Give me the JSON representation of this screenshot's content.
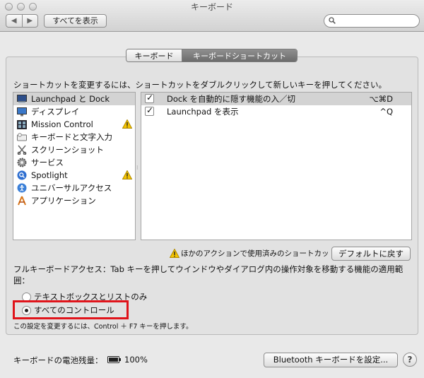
{
  "window": {
    "title": "キーボード"
  },
  "toolbar": {
    "back_glyph": "◀",
    "forward_glyph": "▶",
    "show_all_label": "すべてを表示",
    "search_placeholder": ""
  },
  "tabs": [
    {
      "label": "キーボード",
      "selected": false
    },
    {
      "label": "キーボードショートカット",
      "selected": true
    }
  ],
  "instruction": "ショートカットを変更するには、ショートカットをダブルクリックして新しいキーを押してください。",
  "categories": [
    {
      "label": "Launchpad と Dock",
      "icon": "launchpad-dock-icon",
      "selected": true,
      "warning": false
    },
    {
      "label": "ディスプレイ",
      "icon": "display-icon",
      "selected": false,
      "warning": false
    },
    {
      "label": "Mission Control",
      "icon": "mission-control-icon",
      "selected": false,
      "warning": true
    },
    {
      "label": "キーボードと文字入力",
      "icon": "keyboard-icon",
      "selected": false,
      "warning": false
    },
    {
      "label": "スクリーンショット",
      "icon": "screenshot-icon",
      "selected": false,
      "warning": false
    },
    {
      "label": "サービス",
      "icon": "services-gear-icon",
      "selected": false,
      "warning": false
    },
    {
      "label": "Spotlight",
      "icon": "spotlight-icon",
      "selected": false,
      "warning": true
    },
    {
      "label": "ユニバーサルアクセス",
      "icon": "universal-access-icon",
      "selected": false,
      "warning": false
    },
    {
      "label": "アプリケーション",
      "icon": "applications-icon",
      "selected": false,
      "warning": false
    }
  ],
  "shortcuts": [
    {
      "label": "Dock を自動的に隠す機能の入／切",
      "key": "⌥⌘D",
      "checked": true,
      "selected": true
    },
    {
      "label": "Launchpad を表示",
      "key": "^Q",
      "checked": true,
      "selected": false
    }
  ],
  "conflict_note": "ほかのアクションで使用済みのショートカット",
  "restore_defaults_label": "デフォルトに戻す",
  "full_keyboard_access": {
    "description": "フルキーボードアクセス：Tab キーを押してウインドウやダイアログ内の操作対象を移動する機能の適用範囲：",
    "options": [
      {
        "label": "テキストボックスとリストのみ",
        "selected": false
      },
      {
        "label": "すべてのコントロール",
        "selected": true
      }
    ],
    "hint": "この設定を変更するには、Control ＋ F7 キーを押します。"
  },
  "battery": {
    "label": "キーボードの電池残量：",
    "value": "100%",
    "level": 1.0
  },
  "bluetooth_button_label": "Bluetooth キーボードを設定...",
  "help_label": "?",
  "colors": {
    "highlight": "#e0141b",
    "warning": "#f5c400",
    "tab_selected": "#7a7a7a"
  }
}
